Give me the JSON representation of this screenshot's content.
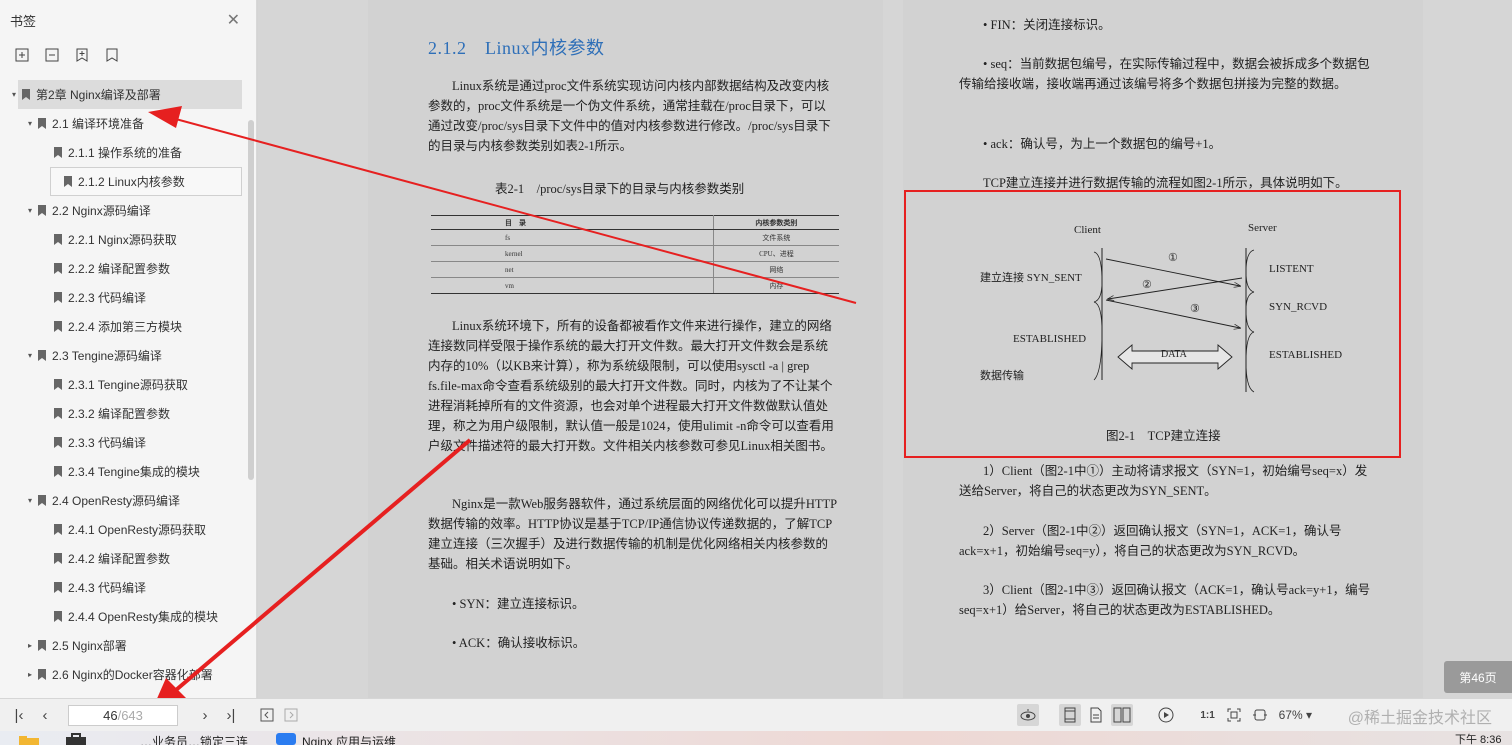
{
  "sidebar": {
    "title": "书签",
    "tree": [
      {
        "label": "第2章 Nginx编译及部署",
        "level": 0,
        "toggle": "▾",
        "state": "selected"
      },
      {
        "label": "2.1 编译环境准备",
        "level": 1,
        "toggle": "▾",
        "state": ""
      },
      {
        "label": "2.1.1 操作系统的准备",
        "level": 2,
        "toggle": "",
        "state": ""
      },
      {
        "label": "2.1.2 Linux内核参数",
        "level": 2,
        "toggle": "",
        "state": "current"
      },
      {
        "label": "2.2 Nginx源码编译",
        "level": 1,
        "toggle": "▾",
        "state": ""
      },
      {
        "label": "2.2.1 Nginx源码获取",
        "level": 2,
        "toggle": "",
        "state": ""
      },
      {
        "label": "2.2.2 编译配置参数",
        "level": 2,
        "toggle": "",
        "state": ""
      },
      {
        "label": "2.2.3 代码编译",
        "level": 2,
        "toggle": "",
        "state": ""
      },
      {
        "label": "2.2.4 添加第三方模块",
        "level": 2,
        "toggle": "",
        "state": ""
      },
      {
        "label": "2.3 Tengine源码编译",
        "level": 1,
        "toggle": "▾",
        "state": ""
      },
      {
        "label": "2.3.1 Tengine源码获取",
        "level": 2,
        "toggle": "",
        "state": ""
      },
      {
        "label": "2.3.2 编译配置参数",
        "level": 2,
        "toggle": "",
        "state": ""
      },
      {
        "label": "2.3.3 代码编译",
        "level": 2,
        "toggle": "",
        "state": ""
      },
      {
        "label": "2.3.4 Tengine集成的模块",
        "level": 2,
        "toggle": "",
        "state": ""
      },
      {
        "label": "2.4 OpenResty源码编译",
        "level": 1,
        "toggle": "▾",
        "state": ""
      },
      {
        "label": "2.4.1 OpenResty源码获取",
        "level": 2,
        "toggle": "",
        "state": ""
      },
      {
        "label": "2.4.2 编译配置参数",
        "level": 2,
        "toggle": "",
        "state": ""
      },
      {
        "label": "2.4.3 代码编译",
        "level": 2,
        "toggle": "",
        "state": ""
      },
      {
        "label": "2.4.4 OpenResty集成的模块",
        "level": 2,
        "toggle": "",
        "state": ""
      },
      {
        "label": "2.5 Nginx部署",
        "level": 1,
        "toggle": "▸",
        "state": ""
      },
      {
        "label": "2.6 Nginx的Docker容器化部署",
        "level": 1,
        "toggle": "▸",
        "state": ""
      }
    ]
  },
  "left_page": {
    "heading": "2.1.2　Linux内核参数",
    "p1": "Linux系统是通过proc文件系统实现访问内核内部数据结构及改变内核参数的，proc文件系统是一个伪文件系统，通常挂载在/proc目录下，可以通过改变/proc/sys目录下文件中的值对内核参数进行修改。/proc/sys目录下的目录与内核参数类别如表2-1所示。",
    "table_caption": "表2-1　/proc/sys目录下的目录与内核参数类别",
    "table": {
      "headers": [
        "目　录",
        "内核参数类别"
      ],
      "rows": [
        [
          "fs",
          "文件系统"
        ],
        [
          "kernel",
          "CPU、进程"
        ],
        [
          "net",
          "网络"
        ],
        [
          "vm",
          "内存"
        ]
      ]
    },
    "p2": "Linux系统环境下，所有的设备都被看作文件来进行操作，建立的网络连接数同样受限于操作系统的最大打开文件数。最大打开文件数会是系统内存的10%（以KB来计算），称为系统级限制，可以使用sysctl -a | grep fs.file-max命令查看系统级别的最大打开文件数。同时，内核为了不让某个进程消耗掉所有的文件资源，也会对单个进程最大打开文件数做默认值处理，称之为用户级限制，默认值一般是1024，使用ulimit -n命令可以查看用户级文件描述符的最大打开数。文件相关内核参数可参见Linux相关图书。",
    "p3": "Nginx是一款Web服务器软件，通过系统层面的网络优化可以提升HTTP数据传输的效率。HTTP协议是基于TCP/IP通信协议传递数据的，了解TCP建立连接（三次握手）及进行数据传输的机制是优化网络相关内核参数的基础。相关术语说明如下。",
    "b1": "• SYN：建立连接标识。",
    "b2": "• ACK：确认接收标识。"
  },
  "right_page": {
    "b_fin": "• FIN：关闭连接标识。",
    "b_seq": "• seq：当前数据包编号，在实际传输过程中，数据会被拆成多个数据包传输给接收端，接收端再通过该编号将多个数据包拼接为完整的数据。",
    "b_ack": "• ack：确认号，为上一个数据包的编号+1。",
    "intro": "TCP建立连接并进行数据传输的流程如图2-1所示，具体说明如下。",
    "figure": {
      "client": "Client",
      "server": "Server",
      "left_label_1": "建立连接 SYN_SENT",
      "left_label_2": "ESTABLISHED",
      "left_label_3": "数据传输",
      "right_label_1": "LISTENT",
      "right_label_2": "SYN_RCVD",
      "right_label_3": "ESTABLISHED",
      "step1": "①",
      "step2": "②",
      "step3": "③",
      "data": "DATA",
      "caption": "图2-1　TCP建立连接"
    },
    "s1": "1）Client（图2-1中①）主动将请求报文（SYN=1，初始编号seq=x）发送给Server，将自己的状态更改为SYN_SENT。",
    "s2": "2）Server（图2-1中②）返回确认报文（SYN=1，ACK=1，确认号ack=x+1，初始编号seq=y），将自己的状态更改为SYN_RCVD。",
    "s3": "3）Client（图2-1中③）返回确认报文（ACK=1，确认号ack=y+1，编号seq=x+1）给Server，将自己的状态更改为ESTABLISHED。"
  },
  "page_badge": "第46页",
  "bottombar": {
    "page_current": "46",
    "page_total": "/643",
    "zoom": "67%"
  },
  "watermark": "@稀土掘金技术社区",
  "taskbar": {
    "item1": "…业务员…锁定三连",
    "item2": "Nginx 应用与运维",
    "clock": "下午 8:36"
  },
  "colors": {
    "annotation_red": "#e62020",
    "heading_blue": "#2e6fb8"
  }
}
